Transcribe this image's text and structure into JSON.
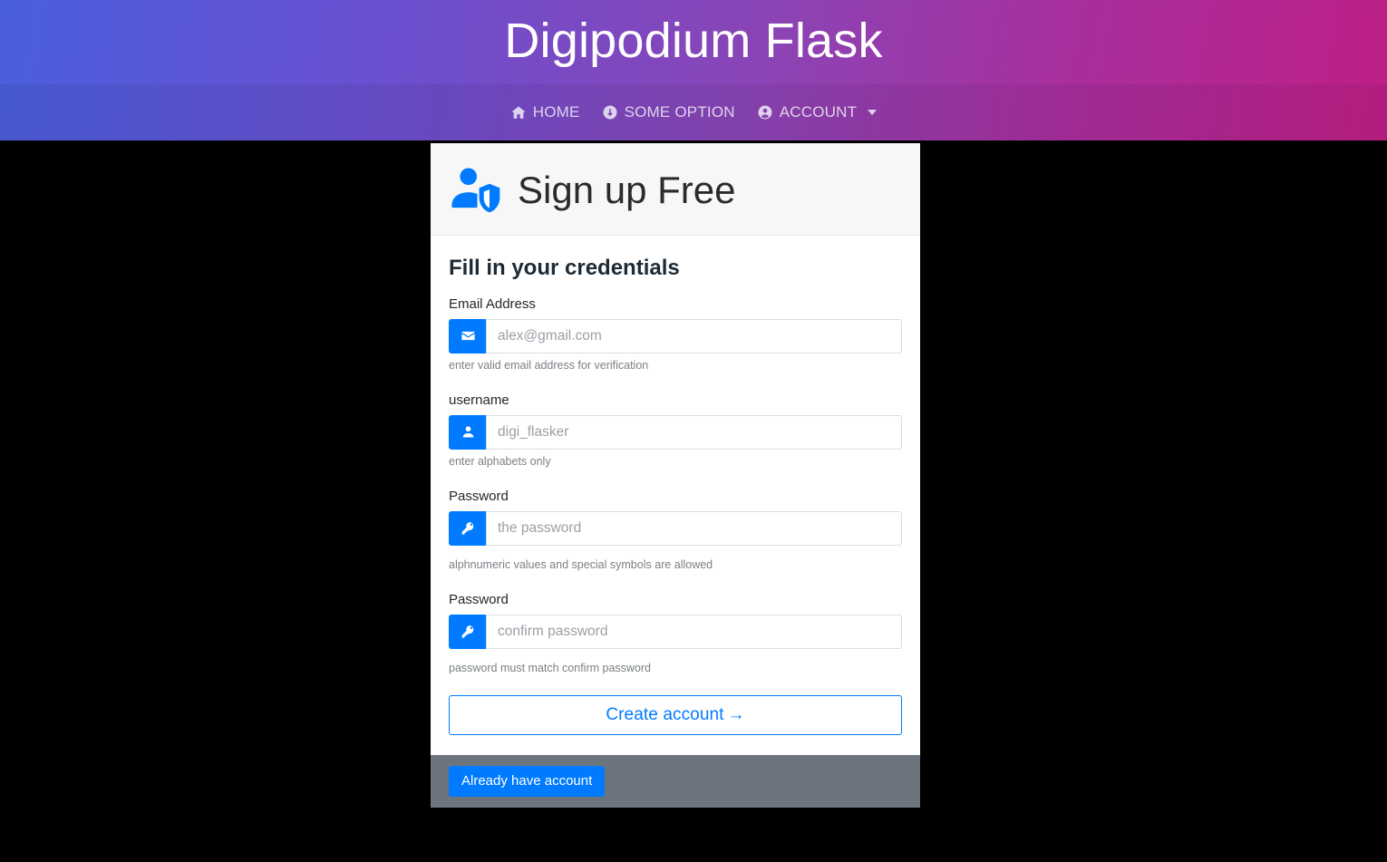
{
  "header": {
    "brand_title": "Digipodium Flask",
    "gradient_start": "#4a5fdd",
    "gradient_mid": "#8b44b5",
    "gradient_end": "#be1f85",
    "nav": [
      {
        "label": "HOME",
        "icon": "home-icon"
      },
      {
        "label": "SOME OPTION",
        "icon": "arrow-circle-down-icon"
      },
      {
        "label": "ACCOUNT",
        "icon": "user-circle-icon",
        "has_caret": true
      }
    ]
  },
  "card": {
    "title": "Sign up Free",
    "title_icon": "user-shield-icon",
    "section_heading": "Fill in your credentials",
    "accent_color": "#007bff",
    "footer_color": "#6c757d",
    "fields": [
      {
        "label": "Email Address",
        "placeholder": "alex@gmail.com",
        "help": "enter valid email address for verification",
        "icon": "envelope-icon",
        "value": ""
      },
      {
        "label": "username",
        "placeholder": "digi_flasker",
        "help": "enter alphabets only",
        "icon": "user-icon",
        "value": ""
      },
      {
        "label": "Password",
        "placeholder": "the password",
        "help": "alphnumeric values and special symbols are allowed",
        "icon": "key-icon",
        "value": ""
      },
      {
        "label": "Password",
        "placeholder": "confirm password",
        "help": "password must match confirm password",
        "icon": "key-icon",
        "value": ""
      }
    ],
    "submit_label": "Create account",
    "submit_arrow": "→",
    "footer_button_label": "Already have account"
  }
}
